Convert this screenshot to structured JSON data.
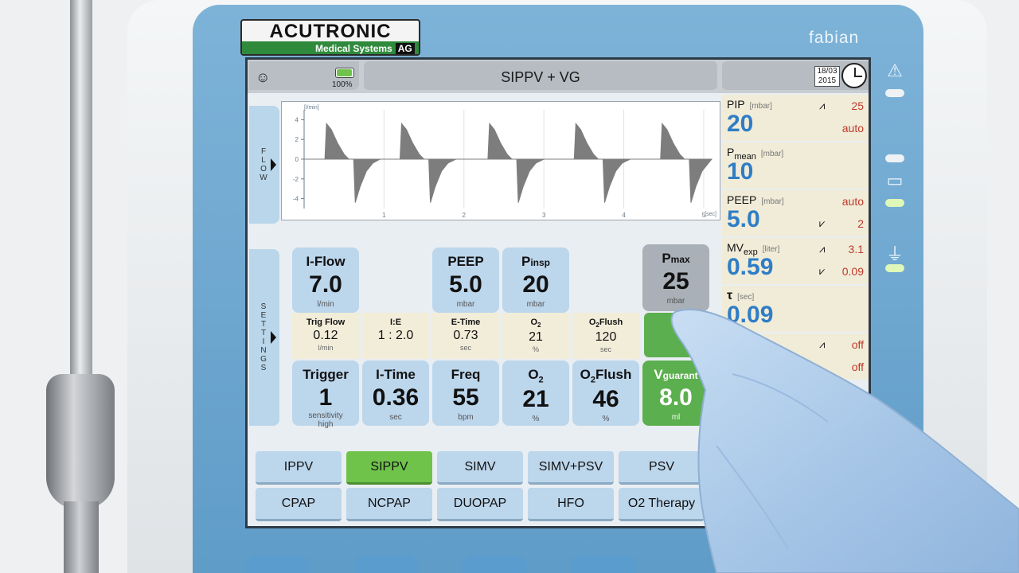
{
  "device": {
    "brand": "ACUTRONIC",
    "brand_sub": "Medical Systems",
    "brand_ag": "AG",
    "model": "fabian"
  },
  "topbar": {
    "battery_level": "100%",
    "mode_title": "SIPPV + VG",
    "date_line1": "18/03",
    "date_line2": "2015"
  },
  "side_tabs": {
    "flow": "FLOW",
    "settings": "SETTINGS"
  },
  "chart_data": {
    "type": "line",
    "title": "",
    "ylabel": "[l/min]",
    "xlabel": "[sec]",
    "ylim": [
      -5,
      5
    ],
    "xlim": [
      0,
      5.1
    ],
    "yticks": [
      "4",
      "2",
      "0",
      "-2",
      "-4"
    ],
    "xticks": [
      "1",
      "2",
      "3",
      "4",
      "5"
    ],
    "fill_color": "#7d7d7d",
    "series": [
      {
        "x": [
          0,
          0.26,
          0.28,
          0.34,
          0.42,
          0.5,
          0.56,
          0.62,
          0.64,
          0.7,
          0.78,
          0.86,
          0.95,
          1.15,
          1.2,
          1.22,
          1.28,
          1.36,
          1.44,
          1.5,
          1.56,
          1.58,
          1.64,
          1.72,
          1.8,
          1.9,
          2.26,
          2.3,
          2.32,
          2.38,
          2.46,
          2.54,
          2.6,
          2.66,
          2.68,
          2.74,
          2.82,
          2.9,
          3.0,
          3.35,
          3.38,
          3.4,
          3.46,
          3.54,
          3.62,
          3.68,
          3.74,
          3.76,
          3.82,
          3.9,
          3.98,
          4.08,
          4.42,
          4.46,
          4.48,
          4.54,
          4.62,
          4.7,
          4.76,
          4.82,
          4.84,
          4.9,
          4.98,
          5.06,
          5.1
        ],
        "y": [
          0,
          0,
          3.6,
          3.0,
          1.6,
          0.5,
          0,
          0,
          -4.4,
          -2.8,
          -1.2,
          -0.4,
          0,
          0,
          0,
          3.6,
          3.0,
          1.6,
          0.5,
          0,
          0,
          -4.4,
          -2.8,
          -1.2,
          -0.4,
          0,
          0,
          0,
          3.6,
          3.0,
          1.6,
          0.5,
          0,
          0,
          -4.4,
          -2.8,
          -1.2,
          -0.4,
          0,
          0,
          0,
          3.6,
          3.0,
          1.6,
          0.5,
          0,
          0,
          -4.4,
          -2.8,
          -1.2,
          -0.4,
          0,
          0,
          0,
          3.6,
          3.0,
          1.6,
          0.5,
          0,
          0,
          -4.4,
          -2.8,
          -1.2,
          -0.4,
          0
        ]
      }
    ]
  },
  "params": [
    {
      "name": "PIP",
      "unit": "[mbar]",
      "value": "20",
      "r1": "25",
      "r2": "auto",
      "icon1": "upper-alarm-icon"
    },
    {
      "name": "P",
      "sub": "mean",
      "unit": "[mbar]",
      "value": "10"
    },
    {
      "name": "PEEP",
      "unit": "[mbar]",
      "value": "5.0",
      "r1": "auto",
      "r2": "2",
      "icon2": "lower-alarm-icon"
    },
    {
      "name": "MV",
      "sub": "exp",
      "unit": "[liter]",
      "value": "0.59",
      "r1": "3.1",
      "r2": "0.09",
      "icon1": "upper-alarm-icon",
      "icon2": "lower-alarm-icon"
    },
    {
      "name": "τ",
      "unit": "[sec]",
      "value": "0.09"
    },
    {
      "r1": "off",
      "r2": "off",
      "icon1": "upper-alarm-icon"
    }
  ],
  "settings": {
    "iflow": {
      "label": "I-Flow",
      "value": "7.0",
      "unit": "l/min"
    },
    "peep": {
      "label": "PEEP",
      "value": "5.0",
      "unit": "mbar"
    },
    "pinsp": {
      "label": "P",
      "sub": "insp",
      "value": "20",
      "unit": "mbar"
    },
    "pmax": {
      "label": "P",
      "sub": "max",
      "value": "25",
      "unit": "mbar"
    },
    "trigflow": {
      "label": "Trig Flow",
      "value": "0.12",
      "unit": "l/min"
    },
    "ie": {
      "label": "I:E",
      "value": "1 : 2.0"
    },
    "etime": {
      "label": "E-Time",
      "value": "0.73",
      "unit": "sec"
    },
    "o2small": {
      "label": "O",
      "sub": "2",
      "value": "21",
      "unit": "%"
    },
    "o2flushsmall": {
      "label": "O",
      "sub": "2",
      "label2": "Flush",
      "value": "120",
      "unit": "sec"
    },
    "trigger": {
      "label": "Trigger",
      "value": "1",
      "unit1": "sensitivity",
      "unit2": "high"
    },
    "itime": {
      "label": "I-Time",
      "value": "0.36",
      "unit": "sec"
    },
    "freq": {
      "label": "Freq",
      "value": "55",
      "unit": "bpm"
    },
    "o2": {
      "label": "O",
      "sub": "2",
      "value": "21",
      "unit": "%"
    },
    "o2flush": {
      "label": "O",
      "sub": "2",
      "label2": "Flush",
      "value": "46",
      "unit": "%"
    },
    "vguarant": {
      "label": "V",
      "sub": "guarant",
      "value": "8.0",
      "unit": "ml"
    }
  },
  "modes": [
    {
      "label": "IPPV"
    },
    {
      "label": "SIPPV"
    },
    {
      "label": "SIMV"
    },
    {
      "label": "SIMV+PSV"
    },
    {
      "label": "PSV"
    },
    {
      "label": "CPAP"
    },
    {
      "label": "NCPAP"
    },
    {
      "label": "DUOPAP"
    },
    {
      "label": "HFO"
    },
    {
      "label": "O2 Therapy"
    }
  ],
  "active_mode": "SIPPV",
  "colors": {
    "accent_blue": "#2f7dc6",
    "alarm_red": "#c0392b",
    "active_green": "#6fc24a",
    "vg_green": "#5caf4e",
    "tile_blue": "#bcd6ec"
  }
}
